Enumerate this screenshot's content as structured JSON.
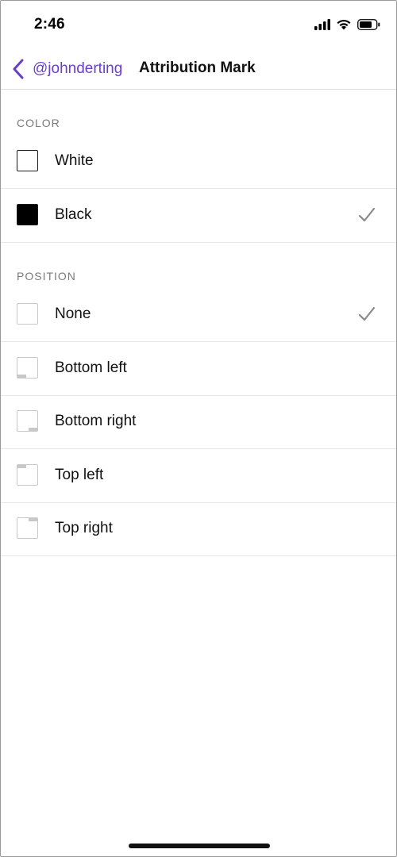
{
  "status_bar": {
    "time": "2:46",
    "icons": [
      "signal-icon",
      "wifi-icon",
      "battery-icon"
    ]
  },
  "nav": {
    "back_label": "@johnderting",
    "title": "Attribution Mark",
    "accent_color": "#6a3fc8"
  },
  "color_section": {
    "header": "COLOR",
    "options": [
      {
        "label": "White",
        "selected": false
      },
      {
        "label": "Black",
        "selected": true
      }
    ]
  },
  "position_section": {
    "header": "POSITION",
    "options": [
      {
        "label": "None",
        "selected": true
      },
      {
        "label": "Bottom left",
        "selected": false
      },
      {
        "label": "Bottom right",
        "selected": false
      },
      {
        "label": "Top left",
        "selected": false
      },
      {
        "label": "Top right",
        "selected": false
      }
    ]
  }
}
